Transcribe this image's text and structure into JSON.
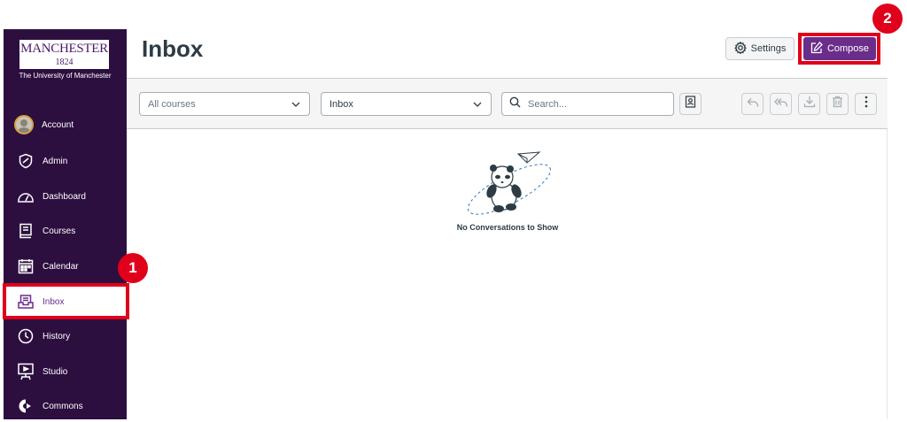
{
  "sidebar": {
    "logo": {
      "name": "MANCHESTER",
      "year": "1824",
      "subtitle": "The University of Manchester"
    },
    "items": [
      {
        "label": "Account",
        "icon": "avatar"
      },
      {
        "label": "Admin",
        "icon": "shield-icon"
      },
      {
        "label": "Dashboard",
        "icon": "dashboard-icon"
      },
      {
        "label": "Courses",
        "icon": "book-icon"
      },
      {
        "label": "Calendar",
        "icon": "calendar-icon"
      },
      {
        "label": "Inbox",
        "icon": "inbox-icon",
        "active": true
      },
      {
        "label": "History",
        "icon": "clock-icon"
      },
      {
        "label": "Studio",
        "icon": "studio-icon"
      },
      {
        "label": "Commons",
        "icon": "commons-icon"
      }
    ]
  },
  "header": {
    "title": "Inbox",
    "settings_label": "Settings",
    "compose_label": "Compose"
  },
  "toolbar": {
    "course_filter": "All courses",
    "mailbox_filter": "Inbox",
    "search_placeholder": "Search..."
  },
  "main": {
    "empty_message": "No Conversations to Show"
  },
  "annotations": {
    "step1": "1",
    "step2": "2"
  },
  "colors": {
    "sidebar_bg": "#2c0f3f",
    "brand_purple": "#6b2d8a",
    "annotation_red": "#e0001b"
  }
}
